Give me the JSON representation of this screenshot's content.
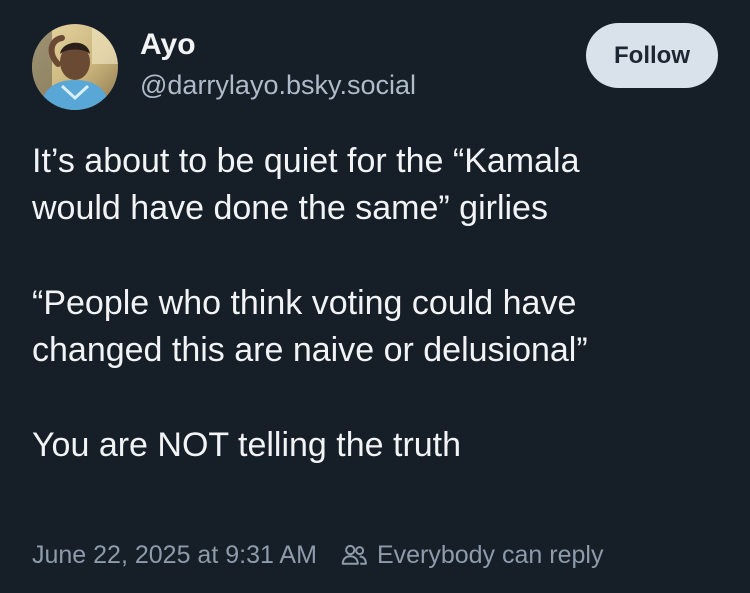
{
  "author": {
    "display_name": "Ayo",
    "handle": "@darrylayo.bsky.social",
    "avatar_icon": "user-photo-avatar"
  },
  "actions": {
    "follow_label": "Follow"
  },
  "post": {
    "paragraphs": [
      "It’s about to be quiet for the “Kamala\nwould have done the same” girlies",
      "“People who think voting could have\nchanged this are naive or delusional”",
      "You are NOT telling the truth"
    ]
  },
  "meta": {
    "timestamp": "June 22, 2025 at 9:31 AM",
    "reply_setting": "Everybody can reply",
    "reply_icon": "people-icon"
  },
  "colors": {
    "background": "#161e27",
    "text": "#f1f3f5",
    "handle": "#aebbc9",
    "meta": "#8d9bab",
    "follow_button_bg": "#d9e1ea"
  }
}
